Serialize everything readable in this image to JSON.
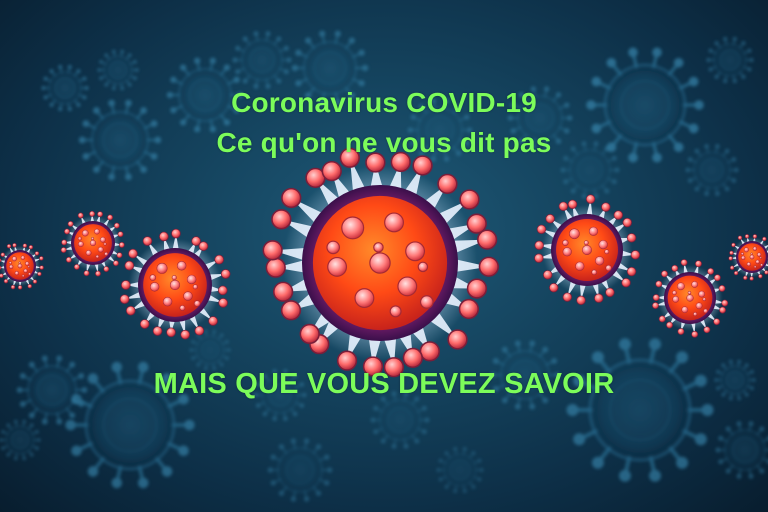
{
  "headline": {
    "line1": "Coronavirus COVID-19",
    "line2": "Ce qu'on ne vous dit pas"
  },
  "tagline": "MAIS QUE VOUS DEVEZ SAVOIR",
  "colors": {
    "text": "#7CFC5A",
    "virus_core": "#ff5a1f",
    "virus_rim": "#7a1e6e",
    "virus_spike": "#ff6f6f",
    "background": "#154560"
  },
  "icons": [
    "virus-icon"
  ]
}
